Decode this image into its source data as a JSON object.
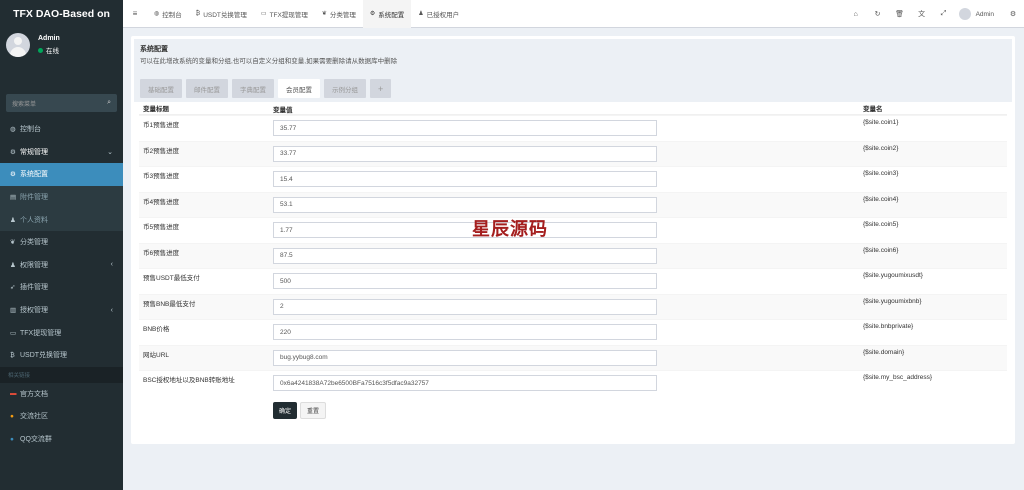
{
  "app": {
    "logo": "TFX DAO-Based on"
  },
  "user": {
    "name": "Admin",
    "status": "在线"
  },
  "sidebar": {
    "search_placeholder": "搜索菜单",
    "items": [
      {
        "label": "控制台",
        "icon": "dashboard-icon",
        "glyph": "◍"
      },
      {
        "label": "常规管理",
        "icon": "cogs-icon",
        "glyph": "⚙",
        "arrow": "⌄"
      },
      {
        "label": "系统配置",
        "icon": "gear-icon",
        "glyph": "⚙"
      },
      {
        "label": "附件管理",
        "icon": "file-image-icon",
        "glyph": "▤"
      },
      {
        "label": "个人资料",
        "icon": "user-icon",
        "glyph": "♟"
      },
      {
        "label": "分类管理",
        "icon": "leaf-icon",
        "glyph": "❦"
      },
      {
        "label": "权限管理",
        "icon": "group-icon",
        "glyph": "♟",
        "arrow": "‹"
      },
      {
        "label": "插件管理",
        "icon": "rocket-icon",
        "glyph": "➶"
      },
      {
        "label": "授权管理",
        "icon": "list-icon",
        "glyph": "▥",
        "arrow": "‹"
      },
      {
        "label": "TFX提现管理",
        "icon": "money-icon",
        "glyph": "▭"
      },
      {
        "label": "USDT兑换管理",
        "icon": "bitcoin-icon",
        "glyph": "₿"
      }
    ],
    "header": "相关链接",
    "links": [
      {
        "label": "官方文档",
        "icon": "book-icon",
        "glyph": "▬",
        "color": "#dd4b39"
      },
      {
        "label": "交流社区",
        "icon": "comments-icon",
        "glyph": "●",
        "color": "#f39c12"
      },
      {
        "label": "QQ交流群",
        "icon": "qq-icon",
        "glyph": "●",
        "color": "#3c8dbc"
      }
    ]
  },
  "header": {
    "tabs": [
      {
        "label": "控制台",
        "icon": "dashboard-icon",
        "glyph": "◍"
      },
      {
        "label": "USDT兑换管理",
        "icon": "bitcoin-icon",
        "glyph": "₿"
      },
      {
        "label": "TFX提现管理",
        "icon": "money-icon",
        "glyph": "▭"
      },
      {
        "label": "分类管理",
        "icon": "leaf-icon",
        "glyph": "❦"
      },
      {
        "label": "系统配置",
        "icon": "gear-icon",
        "glyph": "⚙"
      },
      {
        "label": "已授权用户",
        "icon": "user-icon",
        "glyph": "♟"
      }
    ],
    "user_name": "Admin"
  },
  "config": {
    "title": "系统配置",
    "description": "可以在此增改系统的变量和分组,也可以自定义分组和变量,如果需要删除请从数据库中删除",
    "tabs": [
      "基础配置",
      "邮件配置",
      "字典配置",
      "会员配置",
      "示例分组",
      "+"
    ],
    "columns": [
      "变量标题",
      "变量值",
      "变量名"
    ],
    "rows": [
      {
        "title": "币1预售进度",
        "value": "35.77",
        "name": "{$site.coin1}"
      },
      {
        "title": "币2预售进度",
        "value": "33.77",
        "name": "{$site.coin2}"
      },
      {
        "title": "币3预售进度",
        "value": "15.4",
        "name": "{$site.coin3}"
      },
      {
        "title": "币4预售进度",
        "value": "53.1",
        "name": "{$site.coin4}"
      },
      {
        "title": "币5预售进度",
        "value": "1.77",
        "name": "{$site.coin5}"
      },
      {
        "title": "币6预售进度",
        "value": "87.5",
        "name": "{$site.coin6}"
      },
      {
        "title": "预售USDT最低支付",
        "value": "500",
        "name": "{$site.yugoumixusdt}"
      },
      {
        "title": "预售BNB最低支付",
        "value": "2",
        "name": "{$site.yugoumixbnb}"
      },
      {
        "title": "BNB价格",
        "value": "220",
        "name": "{$site.bnbprivate}"
      },
      {
        "title": "网站URL",
        "value": "bug.yybug8.com",
        "name": "{$site.domain}"
      },
      {
        "title": "BSC授权地址以及BNB转账地址",
        "value": "0x6a4241838A72be6500BFa7516c3f5dfac9a32757",
        "name": "{$site.my_bsc_address}"
      }
    ],
    "submit_label": "确定",
    "reset_label": "重置"
  },
  "watermark": "星辰源码"
}
